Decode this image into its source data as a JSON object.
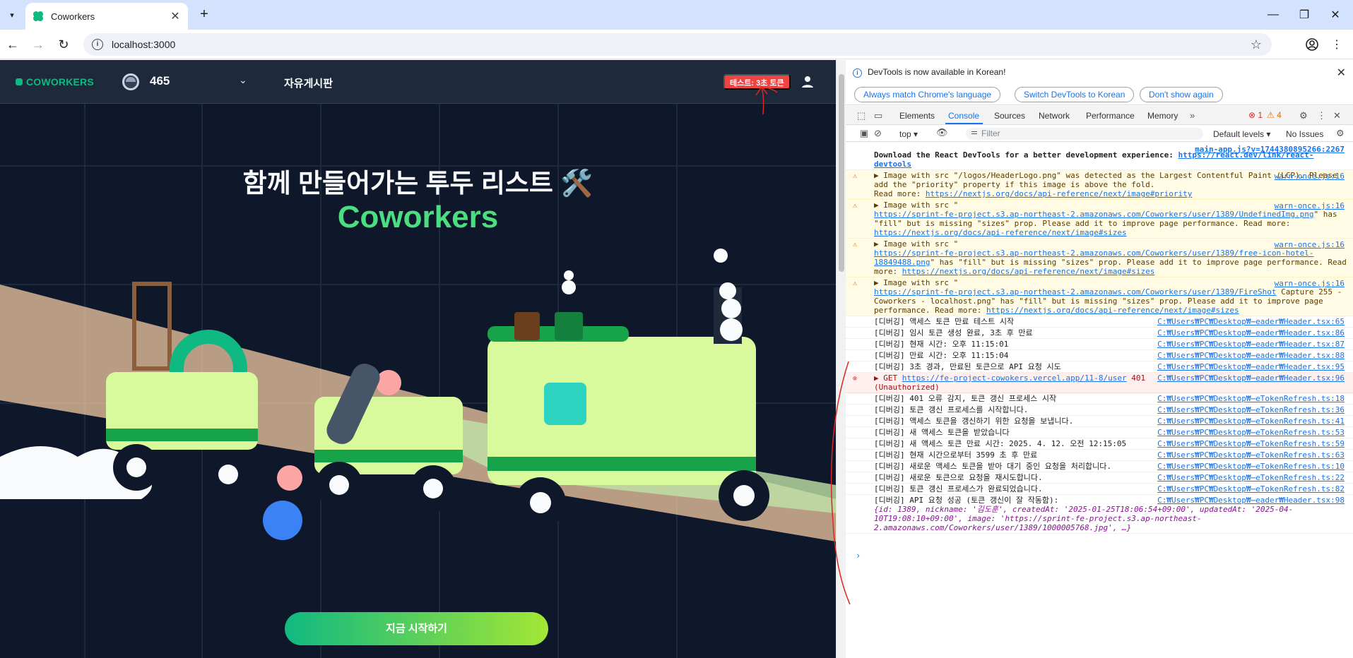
{
  "browser": {
    "tab_title": "Coworkers",
    "url": "localhost:3000"
  },
  "header": {
    "logo": "COWORKERS",
    "team_name": "465",
    "board_link": "자유게시판",
    "test_button": "테스트: 3초 토큰"
  },
  "hero": {
    "title": "함께 만들어가는 투두 리스트 🛠️",
    "subtitle": "Coworkers",
    "cta": "지금 시작하기"
  },
  "devtools": {
    "banner_text": "DevTools is now available in Korean!",
    "banner_buttons": [
      "Always match Chrome's language",
      "Switch DevTools to Korean",
      "Don't show again"
    ],
    "tabs": [
      "Elements",
      "Console",
      "Sources",
      "Network",
      "Performance",
      "Memory"
    ],
    "error_count": "1",
    "warn_count": "4",
    "context": "top ▾",
    "filter_placeholder": "Filter",
    "levels": "Default levels ▾",
    "issues": "No Issues",
    "logs": [
      {
        "type": "info",
        "text": "Download the React DevTools for a better development experience: ",
        "link": "https://react.dev/link/react-devtools",
        "src": "main-app.js?v=1744380895266:2267"
      },
      {
        "type": "warn",
        "text": "▶ Image with src \"/logos/HeaderLogo.png\" was detected as the Largest Contentful Paint (LCP). Please add the \"priority\" property if this image is above the fold.\nRead more: ",
        "link": "https://nextjs.org/docs/api-reference/next/image#priority",
        "src": "warn-once.js:16"
      },
      {
        "type": "warn",
        "text": "▶ Image with src \"\n",
        "link": "https://sprint-fe-project.s3.ap-northeast-2.amazonaws.com/Coworkers/user/1389/UndefinedImg.png",
        "text2": "\" has \"fill\" but is missing \"sizes\" prop. Please add it to improve page performance. Read more: ",
        "link2": "https://nextjs.org/docs/api-reference/next/image#sizes",
        "src": "warn-once.js:16"
      },
      {
        "type": "warn",
        "text": "▶ Image with src \"\n",
        "link": "https://sprint-fe-project.s3.ap-northeast-2.amazonaws.com/Coworkers/user/1389/free-icon-hotel-18849488.png",
        "text2": "\" has \"fill\" but is missing \"sizes\" prop. Please add it to improve page performance. Read more: ",
        "link2": "https://nextjs.org/docs/api-reference/next/image#sizes",
        "src": "warn-once.js:16"
      },
      {
        "type": "warn",
        "text": "▶ Image with src \"\n",
        "link": "https://sprint-fe-project.s3.ap-northeast-2.amazonaws.com/Coworkers/user/1389/FireShot",
        "text2": " Capture 255 - Coworkers - localhost.png\" has \"fill\" but is missing \"sizes\" prop. Please add it to improve page performance. Read more: ",
        "link2": "https://nextjs.org/docs/api-reference/next/image#sizes",
        "src": "warn-once.js:16"
      },
      {
        "type": "log",
        "text": "[디버깅] 액세스 토큰 만료 테스트 시작",
        "src": "C:₩Users₩PC₩Desktop₩⋯eader₩Header.tsx:65"
      },
      {
        "type": "log",
        "text": "[디버깅] 임시 토큰 생성 완료, 3초 후 만료",
        "src": "C:₩Users₩PC₩Desktop₩⋯eader₩Header.tsx:86"
      },
      {
        "type": "log",
        "text": "[디버깅] 현재 시간: 오후 11:15:01",
        "src": "C:₩Users₩PC₩Desktop₩⋯eader₩Header.tsx:87"
      },
      {
        "type": "log",
        "text": "[디버깅] 만료 시간: 오후 11:15:04",
        "src": "C:₩Users₩PC₩Desktop₩⋯eader₩Header.tsx:88"
      },
      {
        "type": "log",
        "text": "[디버깅] 3초 경과, 만료된 토큰으로 API 요청 시도",
        "src": "C:₩Users₩PC₩Desktop₩⋯eader₩Header.tsx:95"
      },
      {
        "type": "err",
        "text": "▶ GET ",
        "link": "https://fe-project-cowokers.vercel.app/11-8/user",
        "text2": " 401\n(Unauthorized)",
        "src": "C:₩Users₩PC₩Desktop₩⋯eader₩Header.tsx:96"
      },
      {
        "type": "log",
        "text": "[디버깅] 401 오류 감지, 토큰 갱신 프로세스 시작",
        "src": "C:₩Users₩PC₩Desktop₩⋯eTokenRefresh.ts:18"
      },
      {
        "type": "log",
        "text": "[디버깅] 토큰 갱신 프로세스를 시작합니다.",
        "src": "C:₩Users₩PC₩Desktop₩⋯eTokenRefresh.ts:36"
      },
      {
        "type": "log",
        "text": "[디버깅] 액세스 토큰을 갱신하기 위한 요청을 보냅니다.",
        "src": "C:₩Users₩PC₩Desktop₩⋯eTokenRefresh.ts:41"
      },
      {
        "type": "log",
        "text": "[디버깅] 새 액세스 토큰을 받았습니다",
        "src": "C:₩Users₩PC₩Desktop₩⋯eTokenRefresh.ts:53"
      },
      {
        "type": "log",
        "text": "[디버깅] 새 액세스 토큰 만료 시간: 2025. 4. 12. 오전 12:15:05",
        "src": "C:₩Users₩PC₩Desktop₩⋯eTokenRefresh.ts:59"
      },
      {
        "type": "log",
        "text": "[디버깅] 현재 시간으로부터 3599 초 후 만료",
        "src": "C:₩Users₩PC₩Desktop₩⋯eTokenRefresh.ts:63"
      },
      {
        "type": "log",
        "text": "[디버깅] 새로운 액세스 토큰을 받아 대기 중인 요청을 처리합니다.",
        "src": "C:₩Users₩PC₩Desktop₩⋯eTokenRefresh.ts:10"
      },
      {
        "type": "log",
        "text": "[디버깅] 새로운 토큰으로 요청을 재시도합니다.",
        "src": "C:₩Users₩PC₩Desktop₩⋯eTokenRefresh.ts:22"
      },
      {
        "type": "log",
        "text": "[디버깅] 토큰 갱신 프로세스가 완료되었습니다.",
        "src": "C:₩Users₩PC₩Desktop₩⋯eTokenRefresh.ts:82"
      },
      {
        "type": "log",
        "text": "[디버깅] API 요청 성공 (토큰 갱신이 잘 작동함):",
        "obj": "{id: 1389, nickname: '김도훈', createdAt: '2025-01-25T18:06:54+09:00', updatedAt: '2025-04-10T19:08:10+09:00', image: 'https://sprint-fe-project.s3.ap-northeast-2.amazonaws.com/Coworkers/user/1389/1000005768.jpg', …}",
        "src": "C:₩Users₩PC₩Desktop₩⋯eader₩Header.tsx:98"
      }
    ]
  }
}
